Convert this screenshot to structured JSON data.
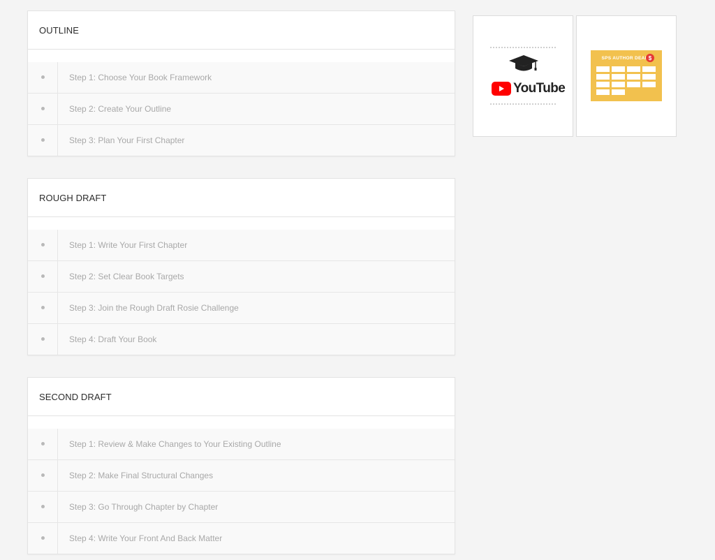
{
  "sections": [
    {
      "title": "OUTLINE",
      "steps": [
        "Step 1: Choose Your Book Framework",
        "Step 2: Create Your Outline",
        "Step 3: Plan Your First Chapter"
      ]
    },
    {
      "title": "ROUGH DRAFT",
      "steps": [
        "Step 1: Write Your First Chapter",
        "Step 2: Set Clear Book Targets",
        "Step 3: Join the Rough Draft Rosie Challenge",
        "Step 4: Draft Your Book"
      ]
    },
    {
      "title": "SECOND DRAFT",
      "steps": [
        "Step 1: Review & Make Changes to Your Existing Outline",
        "Step 2: Make Final Structural Changes",
        "Step 3: Go Through Chapter by Chapter",
        "Step 4: Write Your Front And Back Matter"
      ]
    }
  ],
  "widgets": {
    "youtube": {
      "logo_text": "YouTube",
      "icons": [
        "graduation-cap-icon",
        "youtube-play-icon"
      ]
    },
    "author_deals": {
      "title": "SPS AUTHOR DEALS",
      "badge": "$",
      "tile_count": 14
    }
  },
  "colors": {
    "page_bg": "#f4f4f4",
    "youtube_red": "#ff0000",
    "deals_yellow": "#f2c14e",
    "deals_badge": "#e53935"
  }
}
